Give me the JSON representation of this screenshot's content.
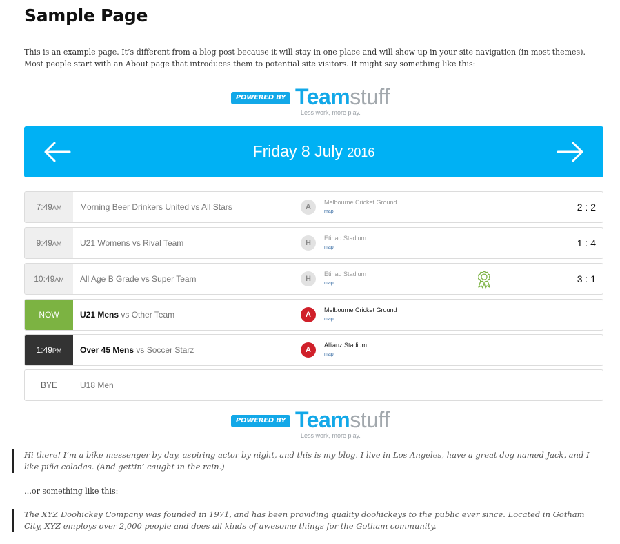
{
  "page": {
    "title": "Sample Page",
    "intro": "This is an example page. It’s different from a blog post because it will stay in one place and will show up in your site navigation (in most themes). Most people start with an About page that introduces them to potential site visitors. It might say something like this:"
  },
  "logo": {
    "badge": "POWERED BY",
    "team": "Team",
    "stuff": "stuff",
    "tagline": "Less work, more play."
  },
  "date_bar": {
    "date": "Friday 8 July",
    "year": "2016",
    "prev_icon": "arrow-left-icon",
    "next_icon": "arrow-right-icon",
    "color": "#00b1f4"
  },
  "fixtures": [
    {
      "time": "7:49",
      "ampm": "AM",
      "home": "Morning Beer Drinkers United",
      "vs": " vs All Stars",
      "ha": "A",
      "venue": "Melbourne Cricket Ground",
      "map": "map",
      "score": "2 : 2"
    },
    {
      "time": "9:49",
      "ampm": "AM",
      "home": "U21 Womens",
      "vs": " vs Rival Team",
      "ha": "H",
      "venue": "Etihad Stadium",
      "map": "map",
      "score": "1 : 4"
    },
    {
      "time": "10:49",
      "ampm": "AM",
      "home": "All Age B Grade",
      "vs": " vs Super Team",
      "ha": "H",
      "venue": "Etihad Stadium",
      "map": "map",
      "score": "3 : 1",
      "award_icon": "award-ribbon-icon"
    },
    {
      "time": "NOW",
      "ampm": "",
      "home": "U21 Mens",
      "vs": " vs Other Team",
      "ha": "A",
      "venue": "Melbourne Cricket Ground",
      "map": "map",
      "score": ""
    },
    {
      "time": "1:49",
      "ampm": "PM",
      "home": "Over 45 Mens",
      "vs": " vs Soccer Starz",
      "ha": "A",
      "venue": "Allianz Stadium",
      "map": "map",
      "score": ""
    },
    {
      "time": "BYE",
      "ampm": "",
      "home": "U18 Men",
      "vs": "",
      "ha": "",
      "venue": "",
      "map": "",
      "score": ""
    }
  ],
  "colors": {
    "now": "#7cb342",
    "upcoming": "#333333",
    "away_badge": "#d0202a"
  },
  "content": {
    "quote1": "Hi there! I’m a bike messenger by day, aspiring actor by night, and this is my blog. I live in Los Angeles, have a great dog named Jack, and I like piña coladas. (And gettin’ caught in the rain.)",
    "middle": "…or something like this:",
    "quote2": "The XYZ Doohickey Company was founded in 1971, and has been providing quality doohickeys to the public ever since. Located in Gotham City, XYZ employs over 2,000 people and does all kinds of awesome things for the Gotham community."
  }
}
